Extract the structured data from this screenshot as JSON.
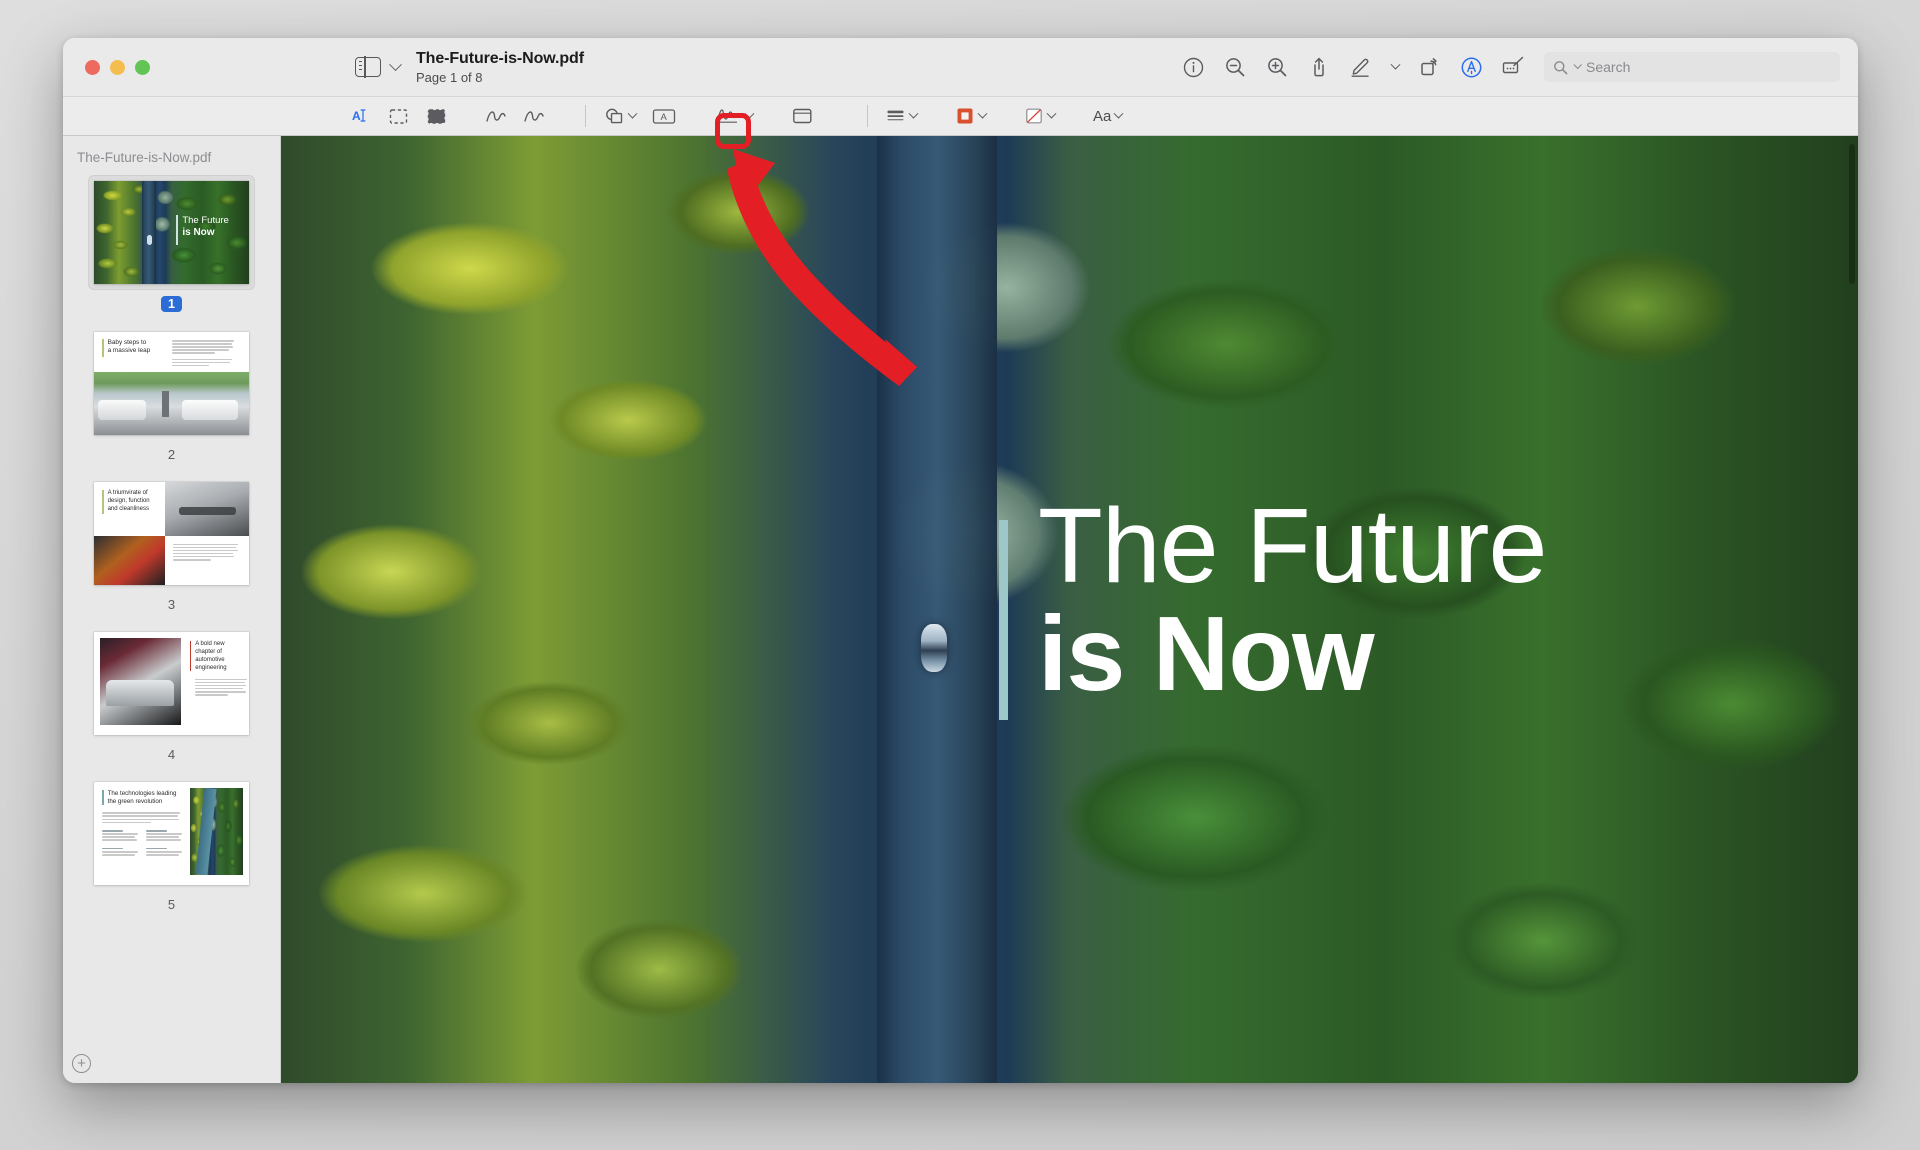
{
  "window": {
    "traffic_lights": [
      "close",
      "minimize",
      "zoom"
    ],
    "document_title": "The-Future-is-Now.pdf",
    "page_status": "Page 1 of 8"
  },
  "toolbar": {
    "sidebar_toggle": "sidebar-toggle",
    "items": [
      {
        "name": "info-icon",
        "label": "Info"
      },
      {
        "name": "zoom-out-icon",
        "label": "Zoom Out"
      },
      {
        "name": "zoom-in-icon",
        "label": "Zoom In"
      },
      {
        "name": "share-icon",
        "label": "Share"
      },
      {
        "name": "markup-pen-icon",
        "label": "Markup"
      },
      {
        "name": "rotate-icon",
        "label": "Rotate"
      },
      {
        "name": "highlight-icon",
        "label": "Highlight"
      },
      {
        "name": "sign-icon",
        "label": "Sign"
      }
    ],
    "search": {
      "placeholder": "Search"
    }
  },
  "markup_toolbar": {
    "items": [
      {
        "name": "text-selection-icon",
        "label": "Text Selection",
        "active": true
      },
      {
        "name": "rectangular-selection-icon",
        "label": "Rectangular Selection"
      },
      {
        "name": "instant-alpha-icon",
        "label": "Instant Alpha"
      },
      {
        "name": "sketch-icon",
        "label": "Sketch"
      },
      {
        "name": "draw-icon",
        "label": "Draw"
      },
      {
        "name": "shapes-icon",
        "label": "Shapes"
      },
      {
        "name": "text-box-icon",
        "label": "Text"
      },
      {
        "name": "signature-icon",
        "label": "Sign"
      },
      {
        "name": "note-icon",
        "label": "Note"
      },
      {
        "name": "shape-style-icon",
        "label": "Shape Style"
      },
      {
        "name": "border-color-icon",
        "label": "Border Color",
        "highlighted": true
      },
      {
        "name": "fill-color-icon",
        "label": "Fill Color"
      },
      {
        "name": "text-style-icon",
        "label": "Aa"
      }
    ],
    "text_style_label": "Aa"
  },
  "sidebar": {
    "title": "The-Future-is-Now.pdf",
    "add_button_label": "+",
    "thumbnails": [
      {
        "page_label": "1",
        "selected": true,
        "kind": "cover",
        "title_line1": "The Future",
        "title_line2": "is Now"
      },
      {
        "page_label": "2",
        "selected": false,
        "kind": "text-top",
        "heading": "Baby steps to\na massive leap"
      },
      {
        "page_label": "3",
        "selected": false,
        "kind": "split",
        "heading": "A triumvirate of\ndesign, function\nand cleanliness"
      },
      {
        "page_label": "4",
        "selected": false,
        "kind": "right",
        "heading": "A bold new\nchapter of\nautomotive\nengineering"
      },
      {
        "page_label": "5",
        "selected": false,
        "kind": "green",
        "heading": "The technologies leading\nthe green revolution"
      }
    ]
  },
  "page_content": {
    "title_line1": "The Future",
    "title_line2": "is Now",
    "accent_bar_color": "#9ec7c9"
  },
  "annotation": {
    "type": "arrow-and-box",
    "color": "#e31e24",
    "target": "border-color-icon"
  }
}
